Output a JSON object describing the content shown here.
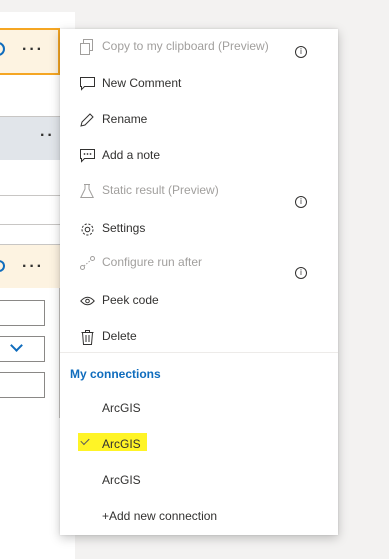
{
  "menu": {
    "items": [
      {
        "label": "Copy to my clipboard (Preview)",
        "icon": "copy-icon",
        "disabled": true,
        "info": true
      },
      {
        "label": "New Comment",
        "icon": "comment-icon",
        "disabled": false,
        "info": false
      },
      {
        "label": "Rename",
        "icon": "pencil-icon",
        "disabled": false,
        "info": false
      },
      {
        "label": "Add a note",
        "icon": "note-icon",
        "disabled": false,
        "info": false
      },
      {
        "label": "Static result (Preview)",
        "icon": "flask-icon",
        "disabled": true,
        "info": true
      },
      {
        "label": "Settings",
        "icon": "gear-icon",
        "disabled": false,
        "info": false
      },
      {
        "label": "Configure run after",
        "icon": "run-after-icon",
        "disabled": true,
        "info": true
      },
      {
        "label": "Peek code",
        "icon": "eye-icon",
        "disabled": false,
        "info": false
      },
      {
        "label": "Delete",
        "icon": "trash-icon",
        "disabled": false,
        "info": false
      }
    ],
    "info_glyph": "i",
    "connections_heading": "My connections",
    "connections": [
      {
        "label": "ArcGIS",
        "selected": false
      },
      {
        "label": "ArcGIS",
        "selected": true
      },
      {
        "label": "ArcGIS",
        "selected": false
      }
    ],
    "add_connection_label": "+Add new connection"
  },
  "background": {
    "ellipsis": "···",
    "ellipsis_short": "··"
  },
  "colors": {
    "accent": "#0f6cbd",
    "highlight": "#fff200",
    "selected_card_border": "#f5a623"
  }
}
